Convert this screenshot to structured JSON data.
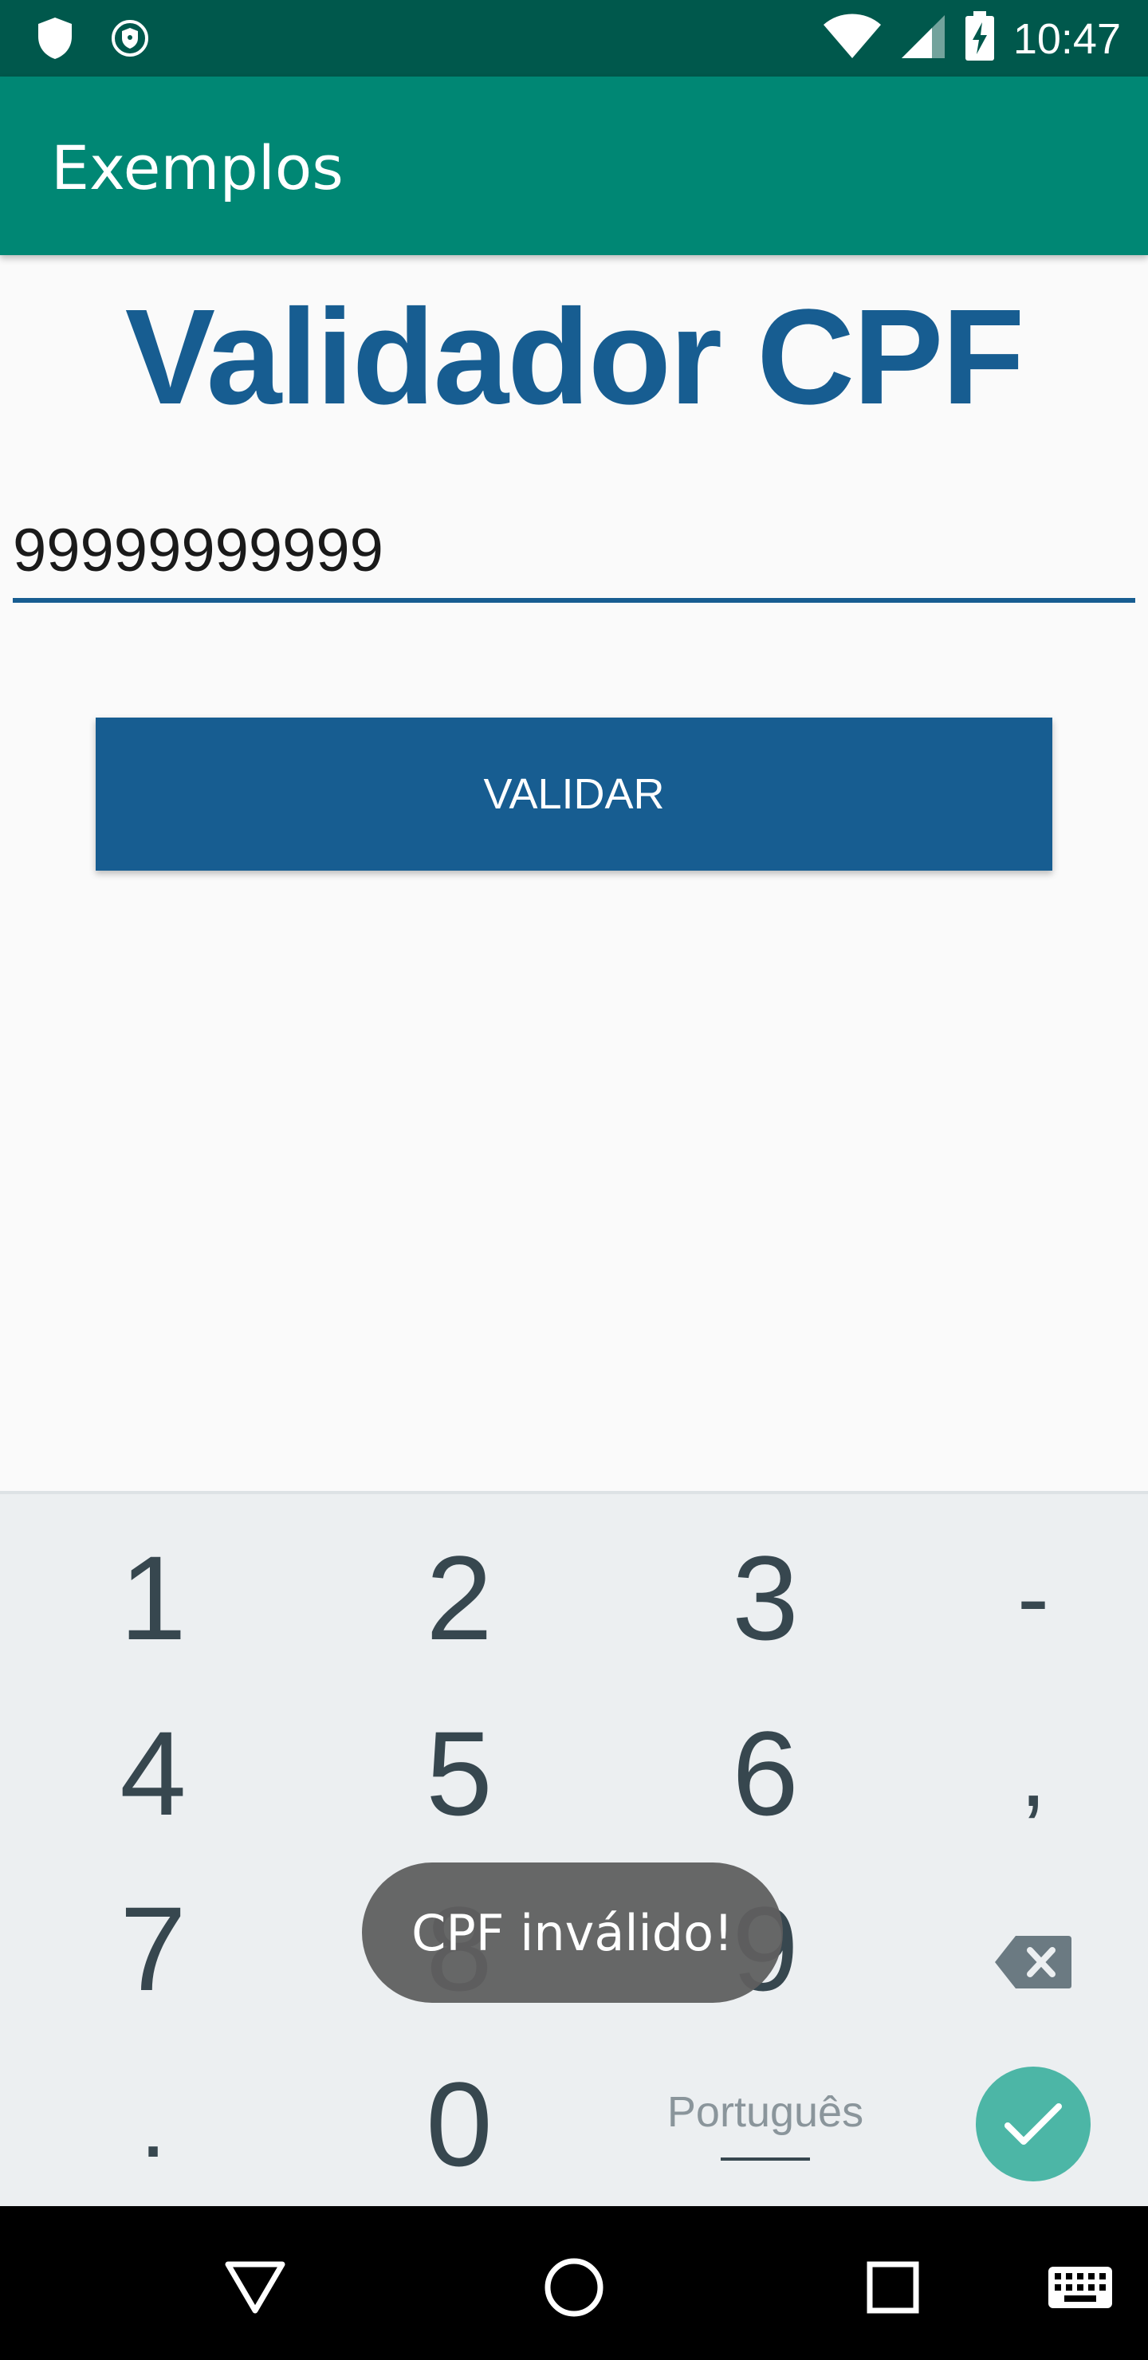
{
  "status_bar": {
    "time": "10:47",
    "icons": [
      "shield-icon",
      "vpn-key-icon",
      "wifi-icon",
      "signal-icon",
      "battery-charging-icon"
    ]
  },
  "app_bar": {
    "title": "Exemplos"
  },
  "main": {
    "page_title": "Validador CPF",
    "cpf_input_value": "99999999999",
    "validate_button_label": "VALIDAR"
  },
  "keyboard": {
    "row1": [
      "1",
      "2",
      "3",
      "-"
    ],
    "row2": [
      "4",
      "5",
      "6",
      ","
    ],
    "row3": [
      "7",
      "8",
      "9"
    ],
    "row4": [
      ".",
      "0"
    ],
    "language_label": "Português",
    "icons": [
      "backspace-icon",
      "done-check-icon"
    ],
    "accent_color": "#4cb6a6"
  },
  "toast": {
    "message": "CPF inválido!"
  },
  "nav_bar": {
    "icons": [
      "back-triangle-icon",
      "home-circle-icon",
      "recents-square-icon",
      "keyboard-icon"
    ]
  },
  "colors": {
    "status_bar": "#00584c",
    "app_bar": "#008774",
    "primary": "#175d91",
    "keyboard_bg": "#eceff1"
  }
}
